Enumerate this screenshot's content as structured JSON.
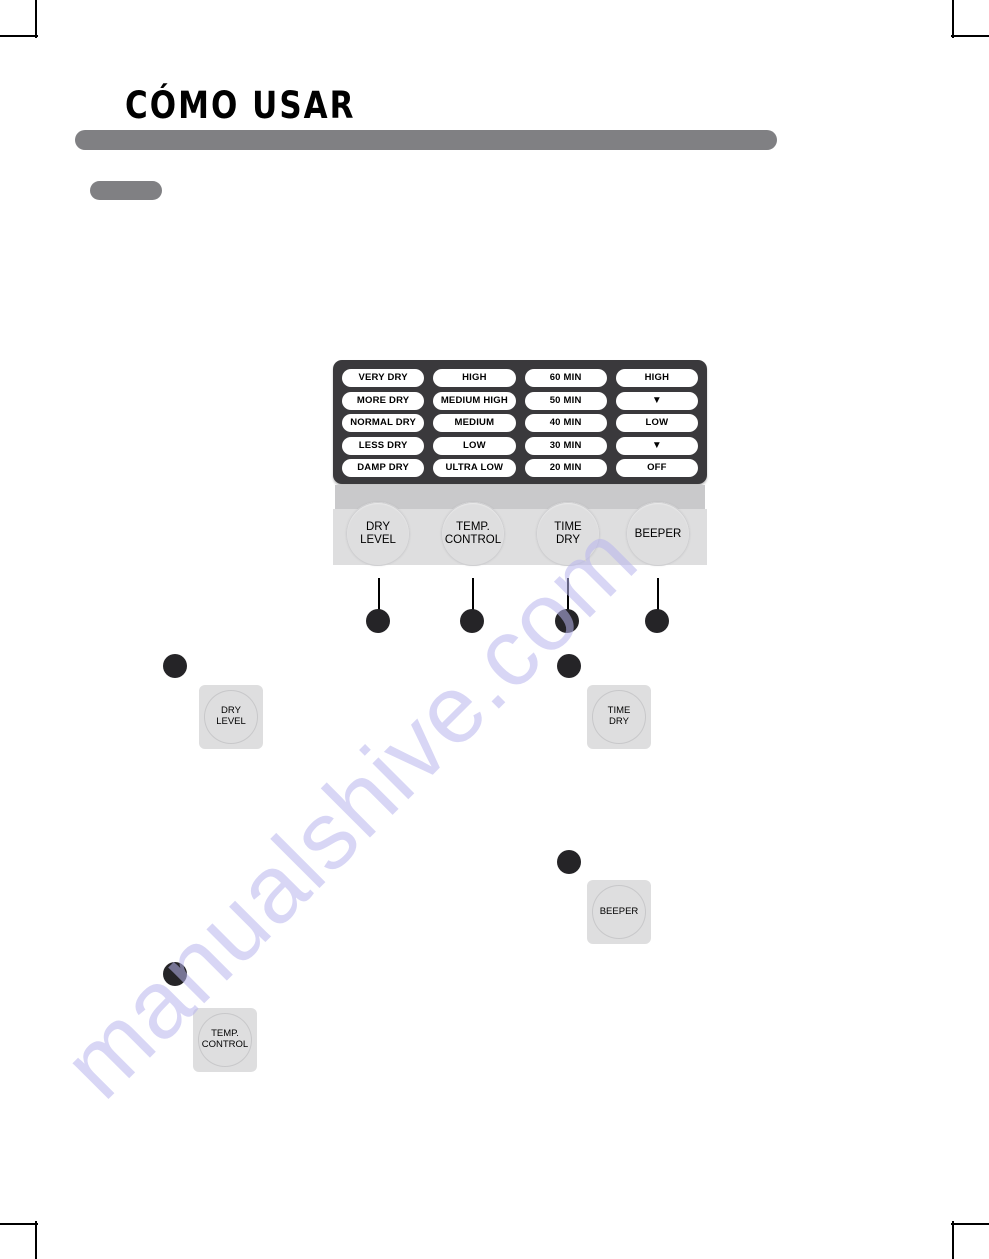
{
  "page": {
    "title": "CÓMO USAR",
    "watermark": "manualshive.com"
  },
  "control_panel": {
    "matrix": {
      "columns": [
        {
          "name": "dry-level-column",
          "cells": [
            "VERY DRY",
            "MORE DRY",
            "NORMAL DRY",
            "LESS DRY",
            "DAMP DRY"
          ]
        },
        {
          "name": "temp-control-column",
          "cells": [
            "HIGH",
            "MEDIUM HIGH",
            "MEDIUM",
            "LOW",
            "ULTRA LOW"
          ]
        },
        {
          "name": "time-dry-column",
          "cells": [
            "60 MIN",
            "50 MIN",
            "40 MIN",
            "30 MIN",
            "20 MIN"
          ]
        },
        {
          "name": "beeper-column",
          "cells": [
            "HIGH",
            "▼",
            "LOW",
            "▼",
            "OFF"
          ]
        }
      ],
      "rows": [
        [
          "VERY DRY",
          "HIGH",
          "60 MIN",
          "HIGH"
        ],
        [
          "MORE DRY",
          "MEDIUM HIGH",
          "50 MIN",
          "▼"
        ],
        [
          "NORMAL DRY",
          "MEDIUM",
          "40 MIN",
          "LOW"
        ],
        [
          "LESS DRY",
          "LOW",
          "30 MIN",
          "▼"
        ],
        [
          "DAMP DRY",
          "ULTRA LOW",
          "20 MIN",
          "OFF"
        ]
      ]
    },
    "knobs": [
      {
        "id": "dry-level",
        "line1": "DRY",
        "line2": "LEVEL"
      },
      {
        "id": "temp-control",
        "line1": "TEMP.",
        "line2": "CONTROL"
      },
      {
        "id": "time-dry",
        "line1": "TIME",
        "line2": "DRY"
      },
      {
        "id": "beeper",
        "line1": "BEEPER",
        "line2": ""
      }
    ]
  },
  "steps": [
    {
      "id": "step-dry-level",
      "line1": "DRY",
      "line2": "LEVEL"
    },
    {
      "id": "step-time-dry",
      "line1": "TIME",
      "line2": "DRY"
    },
    {
      "id": "step-beeper",
      "line1": "BEEPER",
      "line2": ""
    },
    {
      "id": "step-temp-control",
      "line1": "TEMP.",
      "line2": "CONTROL"
    }
  ],
  "colors": {
    "bezel": "#3a393c",
    "panel_light": "#dededf",
    "panel_mid": "#c9c9cb",
    "bar_grey": "#808083",
    "bullet": "#252427",
    "watermark": "#b9b6ee"
  }
}
